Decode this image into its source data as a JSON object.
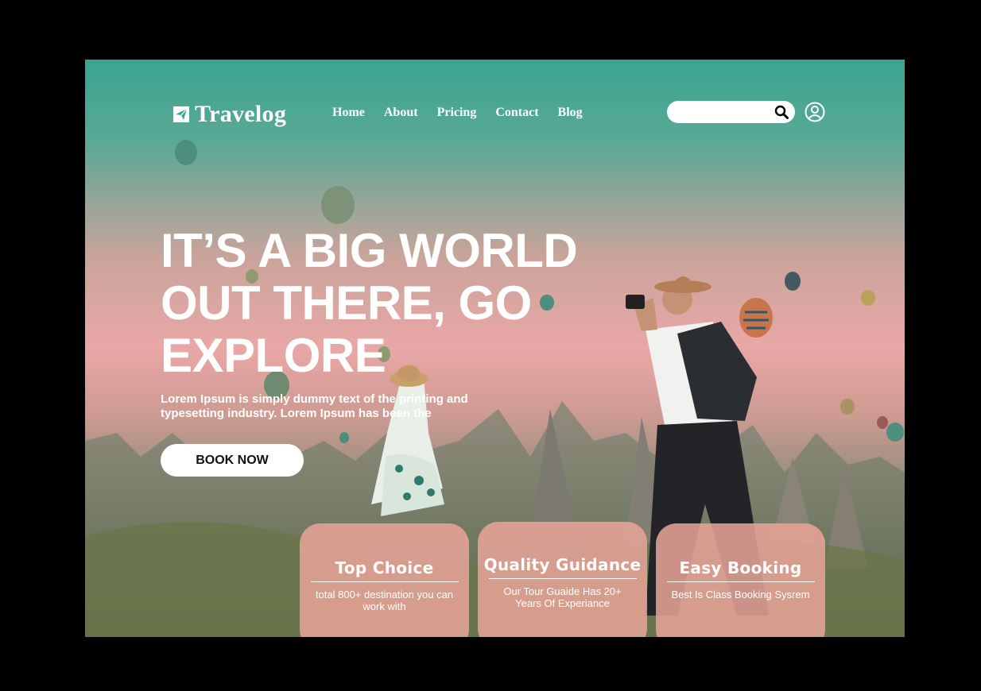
{
  "brand": {
    "name": "Travelog",
    "logo_icon": "paper-plane-icon"
  },
  "nav": {
    "items": [
      "Home",
      "About",
      "Pricing",
      "Contact",
      "Blog"
    ]
  },
  "search": {
    "placeholder": "",
    "value": "",
    "icon": "search-icon"
  },
  "account": {
    "icon": "user-circle-icon"
  },
  "hero": {
    "headline": "IT’S A BIG WORLD OUT THERE, GO EXPLORE",
    "subtext": "Lorem Ipsum is simply dummy text of the printing and typesetting industry. Lorem Ipsum has been the",
    "cta_label": "BOOK NOW"
  },
  "features": [
    {
      "title": "Top Choice",
      "description": "total 800+ destination you can work with"
    },
    {
      "title": "Quality Guidance",
      "description": "Our Tour Guaide Has 20+ Years Of Experiance"
    },
    {
      "title": "Easy Booking",
      "description": "Best Is Class Booking Sysrem"
    }
  ],
  "colors": {
    "teal": "#38a590",
    "pink": "#e9a7a6",
    "card": "#e8a498",
    "text": "#ffffff"
  }
}
